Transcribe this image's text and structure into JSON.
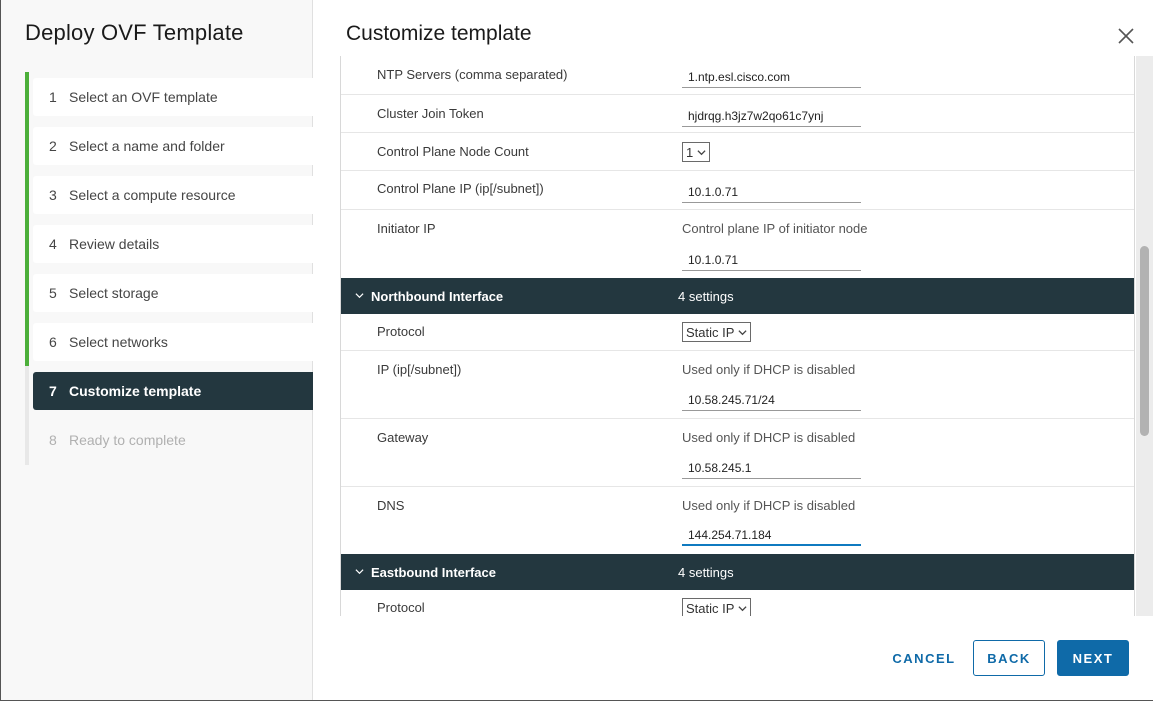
{
  "wizard": {
    "title": "Deploy OVF Template",
    "steps": [
      {
        "num": "1",
        "label": "Select an OVF template",
        "state": "done"
      },
      {
        "num": "2",
        "label": "Select a name and folder",
        "state": "done"
      },
      {
        "num": "3",
        "label": "Select a compute resource",
        "state": "done"
      },
      {
        "num": "4",
        "label": "Review details",
        "state": "done"
      },
      {
        "num": "5",
        "label": "Select storage",
        "state": "done"
      },
      {
        "num": "6",
        "label": "Select networks",
        "state": "done"
      },
      {
        "num": "7",
        "label": "Customize template",
        "state": "active"
      },
      {
        "num": "8",
        "label": "Ready to complete",
        "state": "disabled"
      }
    ]
  },
  "main": {
    "title": "Customize template",
    "close_icon": "close-icon",
    "rows": {
      "ntp": {
        "label": "NTP Servers (comma separated)",
        "value": "1.ntp.esl.cisco.com"
      },
      "token": {
        "label": "Cluster Join Token",
        "value": "hjdrqg.h3jz7w2qo61c7ynj"
      },
      "node_count": {
        "label": "Control Plane Node Count",
        "value": "1"
      },
      "cp_ip": {
        "label": "Control Plane IP (ip[/subnet])",
        "value": "10.1.0.71"
      },
      "initiator": {
        "label": "Initiator IP",
        "description": "Control plane IP of initiator node",
        "value": "10.1.0.71"
      }
    },
    "northbound": {
      "title": "Northbound Interface",
      "count": "4 settings",
      "protocol": {
        "label": "Protocol",
        "value": "Static IP"
      },
      "ip": {
        "label": "IP (ip[/subnet])",
        "description": "Used only if DHCP is disabled",
        "value": "10.58.245.71/24"
      },
      "gateway": {
        "label": "Gateway",
        "description": "Used only if DHCP is disabled",
        "value": "10.58.245.1"
      },
      "dns": {
        "label": "DNS",
        "description": "Used only if DHCP is disabled",
        "value": "144.254.71.184"
      }
    },
    "eastbound": {
      "title": "Eastbound Interface",
      "count": "4 settings",
      "protocol": {
        "label": "Protocol",
        "value": "Static IP"
      }
    }
  },
  "footer": {
    "cancel": "CANCEL",
    "back": "BACK",
    "next": "NEXT"
  },
  "colors": {
    "accent": "#0f6aa8",
    "header_dark": "#23373f",
    "progress_green": "#4caf3a",
    "focus_blue": "#0f7ac0"
  }
}
